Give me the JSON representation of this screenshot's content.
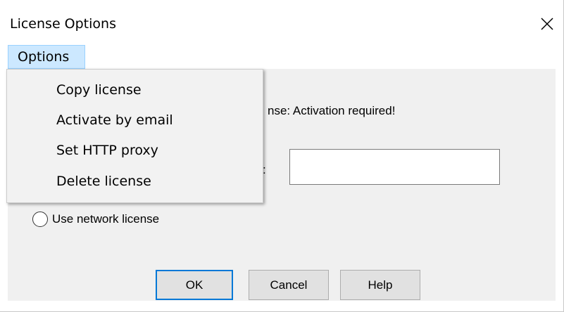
{
  "window": {
    "title": "License Options",
    "close_icon": "close-icon",
    "colors": {
      "menu_highlight": "#cce8ff",
      "menu_highlight_border": "#99d1ff",
      "client_bg": "#f0f0f0",
      "default_button_border": "#0078d7"
    }
  },
  "menubar": {
    "options_label": "Options"
  },
  "dropdown": {
    "items": [
      {
        "label": "Copy license"
      },
      {
        "label": "Activate by email"
      },
      {
        "label": "Set HTTP proxy"
      },
      {
        "label": "Delete license"
      }
    ]
  },
  "content": {
    "status_text": "nse: Activation required!",
    "colon_fragment": ":",
    "license_input_value": "",
    "network_license_label": "Use network license",
    "network_license_selected": false
  },
  "buttons": {
    "ok": "OK",
    "cancel": "Cancel",
    "help": "Help"
  }
}
